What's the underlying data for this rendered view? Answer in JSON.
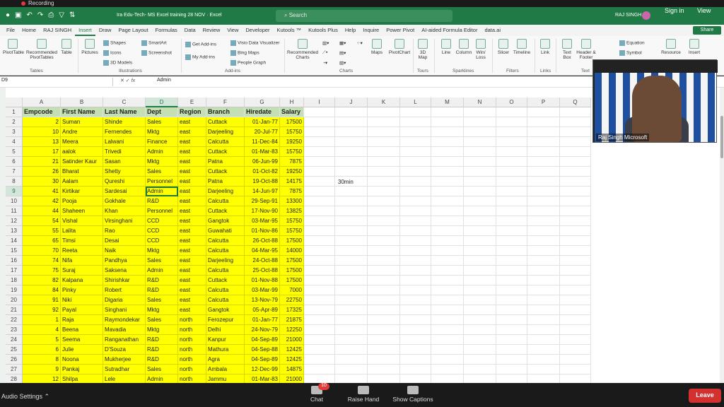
{
  "recording": {
    "label": "Recording"
  },
  "titlebar": {
    "doc_title": "Ira Edu-Tech- MS Excel training 28 NOV  ·  Excel",
    "search_placeholder": "Search",
    "user": "RAJ SINGH",
    "sign_in": "Sign in",
    "view": "View"
  },
  "menu": [
    "File",
    "Home",
    "RAJ SINGH",
    "Insert",
    "Draw",
    "Page Layout",
    "Formulas",
    "Data",
    "Review",
    "View",
    "Developer",
    "Kutools ™",
    "Kutools Plus",
    "Help",
    "Inquire",
    "Power Pivot",
    "AI-aided Formula Editor",
    "data.ai"
  ],
  "share_label": "Share",
  "ribbon": {
    "pivottable": "PivotTable",
    "recommended_pivottables": "Recommended PivotTables",
    "table": "Table",
    "pictures": "Pictures",
    "shapes": "Shapes",
    "icons": "Icons",
    "models_3d": "3D Models",
    "smartart": "SmartArt",
    "screenshot": "Screenshot",
    "get_addins": "Get Add-ins",
    "my_addins": "My Add-ins",
    "visio": "Visio Data Visualizer",
    "bing_maps": "Bing Maps",
    "people_graph": "People Graph",
    "recommended_charts": "Recommended Charts",
    "maps": "Maps",
    "pivotchart": "PivotChart",
    "map_3d": "3D Map",
    "line": "Line",
    "column": "Column",
    "winloss": "Win/ Loss",
    "slicer": "Slicer",
    "timeline": "Timeline",
    "link": "Link",
    "textbox": "Text Box",
    "header_footer": "Header & Footer",
    "equation": "Equation",
    "symbol": "Symbol",
    "resource": "Resource",
    "insert": "Insert",
    "groups": {
      "tables": "Tables",
      "illustrations": "Illustrations",
      "addins": "Add-ins",
      "charts": "Charts",
      "tours": "Tours",
      "sparklines": "Sparklines",
      "filters": "Filters",
      "links": "Links",
      "text": "Text"
    }
  },
  "formula_bar": {
    "name_box": "D9",
    "fx": "fx",
    "value": "Admin"
  },
  "columns": [
    "A",
    "B",
    "C",
    "D",
    "E",
    "F",
    "G",
    "H",
    "I",
    "J",
    "K",
    "L",
    "M",
    "N",
    "O",
    "P",
    "Q"
  ],
  "headers": [
    "Empcode",
    "First Name",
    "Last Name",
    "Dept",
    "Region",
    "Branch",
    "Hiredate",
    "Salary"
  ],
  "rows": [
    [
      "2",
      "Suman",
      "Shinde",
      "Sales",
      "east",
      "Cuttack",
      "01-Jan-77",
      "17500"
    ],
    [
      "10",
      "Andre",
      "Fernendes",
      "Mktg",
      "east",
      "Darjeeling",
      "20-Jul-77",
      "15750"
    ],
    [
      "13",
      "Meera",
      "Lalwani",
      "Finance",
      "east",
      "Calcutta",
      "11-Dec-84",
      "19250"
    ],
    [
      "17",
      "aalok",
      "Trivedi",
      "Admin",
      "east",
      "Cuttack",
      "01-Mar-83",
      "15750"
    ],
    [
      "21",
      "Satinder Kaur",
      "Sasan",
      "Mktg",
      "east",
      "Patna",
      "06-Jun-99",
      "7875"
    ],
    [
      "26",
      "Bharat",
      "Shetty",
      "Sales",
      "east",
      "Cuttack",
      "01-Oct-82",
      "19250"
    ],
    [
      "30",
      "Aalam",
      "Qureshi",
      "Personnel",
      "east",
      "Patna",
      "19-Oct-88",
      "14175"
    ],
    [
      "41",
      "Kirtikar",
      "Sardesai",
      "Admin",
      "east",
      "Darjeeling",
      "14-Jun-97",
      "7875"
    ],
    [
      "42",
      "Pooja",
      "Gokhale",
      "R&D",
      "east",
      "Calcutta",
      "29-Sep-91",
      "13300"
    ],
    [
      "44",
      "Shaheen",
      "Khan",
      "Personnel",
      "east",
      "Cuttack",
      "17-Nov-90",
      "13825"
    ],
    [
      "54",
      "Vishal",
      "Virsinghani",
      "CCD",
      "east",
      "Gangtok",
      "03-Mar-95",
      "15750"
    ],
    [
      "55",
      "Lalita",
      "Rao",
      "CCD",
      "east",
      "Guwahati",
      "01-Nov-86",
      "15750"
    ],
    [
      "65",
      "Timsi",
      "Desai",
      "CCD",
      "east",
      "Calcutta",
      "26-Oct-88",
      "17500"
    ],
    [
      "70",
      "Reeta",
      "Naik",
      "Mktg",
      "east",
      "Calcutta",
      "04-Mar-95",
      "14000"
    ],
    [
      "74",
      "Nifa",
      "Pandhya",
      "Sales",
      "east",
      "Darjeeling",
      "24-Oct-88",
      "17500"
    ],
    [
      "75",
      "Suraj",
      "Saksena",
      "Admin",
      "east",
      "Calcutta",
      "25-Oct-88",
      "17500"
    ],
    [
      "82",
      "Kalpana",
      "Shirishkar",
      "R&D",
      "east",
      "Cuttack",
      "01-Nov-88",
      "17500"
    ],
    [
      "84",
      "Pinky",
      "Robert",
      "R&D",
      "east",
      "Calcutta",
      "03-Mar-99",
      "7000"
    ],
    [
      "91",
      "Niki",
      "Digaria",
      "Sales",
      "east",
      "Calcutta",
      "13-Nov-79",
      "22750"
    ],
    [
      "92",
      "Payal",
      "Singhani",
      "Mktg",
      "east",
      "Gangtok",
      "05-Apr-89",
      "17325"
    ],
    [
      "1",
      "Raja",
      "Raymondekar",
      "Sales",
      "north",
      "Ferozepur",
      "01-Jan-77",
      "21875"
    ],
    [
      "4",
      "Beena",
      "Mavadia",
      "Mktg",
      "north",
      "Delhi",
      "24-Nov-79",
      "12250"
    ],
    [
      "5",
      "Seema",
      "Ranganathan",
      "R&D",
      "north",
      "Kanpur",
      "04-Sep-89",
      "21000"
    ],
    [
      "6",
      "Julie",
      "D'Souza",
      "R&D",
      "north",
      "Mathura",
      "04-Sep-88",
      "12425"
    ],
    [
      "8",
      "Noona",
      "Mukherjee",
      "R&D",
      "north",
      "Agra",
      "04-Sep-89",
      "12425"
    ],
    [
      "9",
      "Pankaj",
      "Sutradhar",
      "Sales",
      "north",
      "Ambala",
      "12-Dec-99",
      "14875"
    ],
    [
      "12",
      "Shilpa",
      "Lele",
      "Admin",
      "north",
      "Jammu",
      "01-Mar-83",
      "21000"
    ]
  ],
  "note_cell": "30min",
  "video": {
    "name": "Raj Singh Microsoft"
  },
  "zoom": {
    "audio_settings": "Audio Settings",
    "chat": "Chat",
    "chat_badge": "10",
    "raise_hand": "Raise Hand",
    "captions": "Show Captions",
    "leave": "Leave"
  }
}
